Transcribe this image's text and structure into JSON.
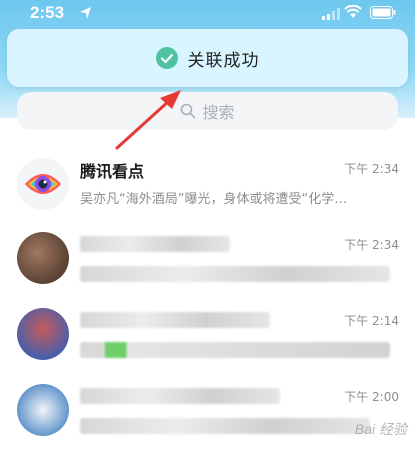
{
  "status_bar": {
    "time": "2:53"
  },
  "toast": {
    "message": "关联成功"
  },
  "search": {
    "placeholder": "搜索"
  },
  "conversations": [
    {
      "title": "腾讯看点",
      "time": "下午 2:34",
      "preview": "吴亦凡“海外酒局”曝光，身体或将遭受“化学…"
    },
    {
      "title": "",
      "time": "下午 2:34",
      "preview": ""
    },
    {
      "title": "",
      "time": "下午 2:14",
      "preview": ""
    },
    {
      "title": "",
      "time": "下午 2:00",
      "preview": ""
    }
  ],
  "watermark": {
    "text": "Bai 经验"
  },
  "colors": {
    "header": "#8fd8f6",
    "check": "#4fc3a1",
    "arrow": "#e53935"
  }
}
